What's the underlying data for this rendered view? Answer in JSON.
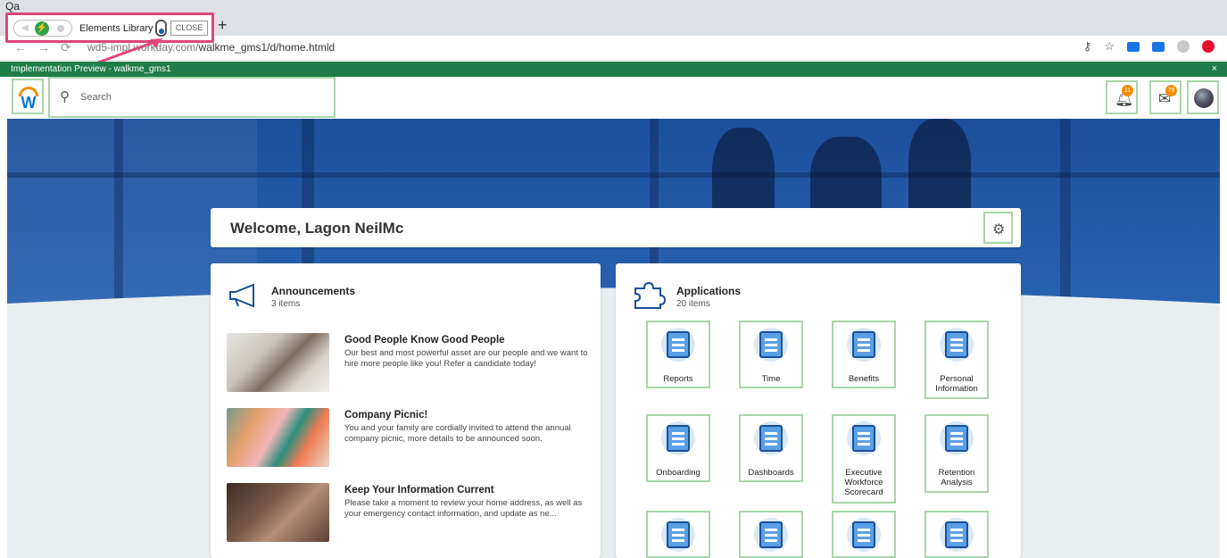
{
  "browser": {
    "tab_title": "Qa",
    "new_tab": "+",
    "url_host": "wd5-impl.workday.com/",
    "url_path": "walkme_gms1/d/home.htmld",
    "nav_glyphs": "←→⟳"
  },
  "extension": {
    "label": "Elements Library",
    "close_label": "CLOSE"
  },
  "preview_bar": {
    "text": "Implementation Preview - walkme_gms1",
    "close": "×"
  },
  "header": {
    "logo_letter": "W",
    "search_placeholder": "Search",
    "notifications_count": "11",
    "inbox_count": "79"
  },
  "welcome": {
    "title": "Welcome, Lagon NeilMc"
  },
  "announcements": {
    "title": "Announcements",
    "count": "3 items",
    "items": [
      {
        "title": "Good People Know Good People",
        "body": "Our best and most powerful asset are our people and we want to hire more people like you! Refer a candidate today!"
      },
      {
        "title": "Company Picnic!",
        "body": "You and your family are cordially invited to attend the annual company picnic, more details to be announced soon."
      },
      {
        "title": "Keep Your Information Current",
        "body": "Please take a moment to review your home address, as well as your emergency contact information, and update as ne..."
      }
    ]
  },
  "applications": {
    "title": "Applications",
    "count": "20 items",
    "tiles": [
      {
        "label": "Reports"
      },
      {
        "label": "Time"
      },
      {
        "label": "Benefits"
      },
      {
        "label": "Personal Information"
      },
      {
        "label": "Onboarding"
      },
      {
        "label": "Dashboards"
      },
      {
        "label": "Executive Workforce Scorecard"
      },
      {
        "label": "Retention Analysis"
      },
      {
        "label": ""
      },
      {
        "label": ""
      },
      {
        "label": ""
      },
      {
        "label": ""
      }
    ]
  },
  "colors": {
    "workday_blue": "#0875e1",
    "workday_orange": "#f38b00",
    "preview_green": "#1e7d49",
    "highlight_green": "#a9d5a9",
    "annotation_pink": "#e0457b"
  }
}
